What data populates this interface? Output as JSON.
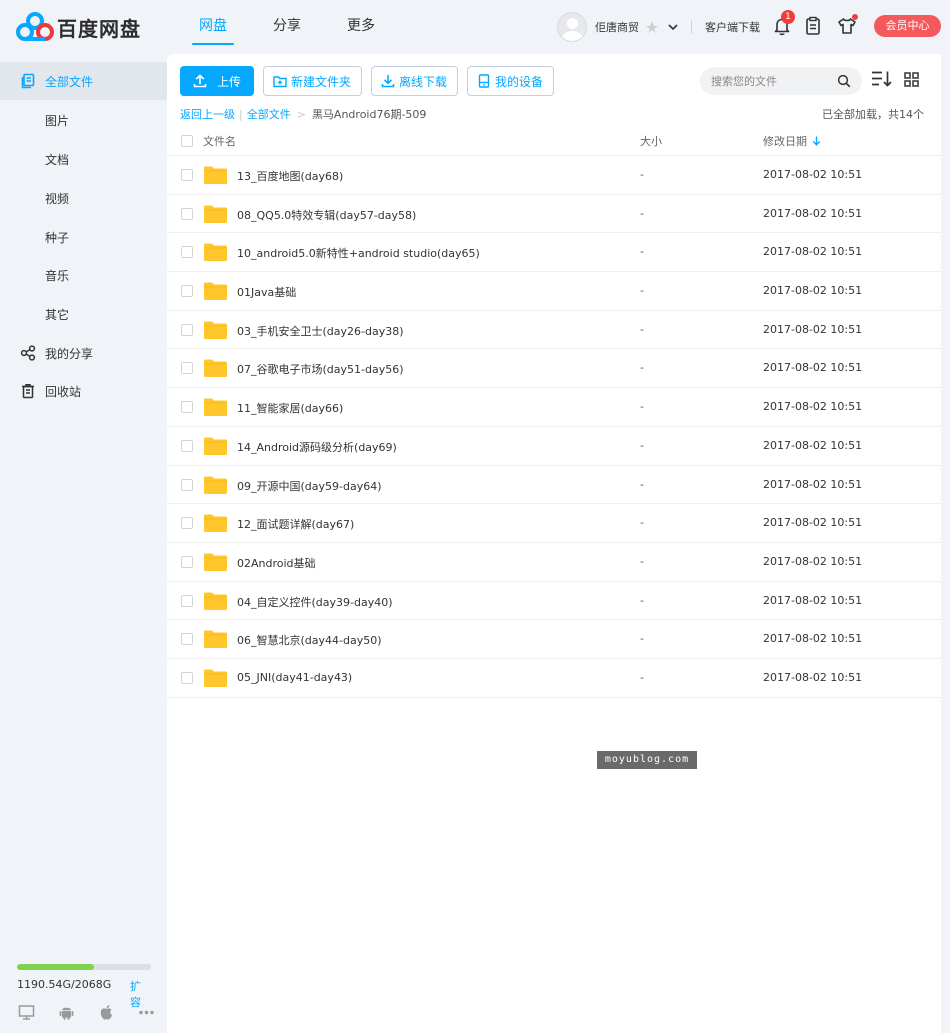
{
  "header": {
    "logo_text": "百度网盘",
    "nav": [
      {
        "label": "网盘",
        "active": true
      },
      {
        "label": "分享",
        "active": false
      },
      {
        "label": "更多",
        "active": false
      }
    ],
    "username": "佢唐商贸",
    "client_download": "客户端下载",
    "notification_count": "1",
    "vip_button": "会员中心"
  },
  "sidebar": {
    "items": [
      {
        "label": "全部文件",
        "icon": "folder-files-icon",
        "active": true
      },
      {
        "label": "图片"
      },
      {
        "label": "文档"
      },
      {
        "label": "视频"
      },
      {
        "label": "种子"
      },
      {
        "label": "音乐"
      },
      {
        "label": "其它"
      },
      {
        "label": "我的分享",
        "icon": "share-icon"
      },
      {
        "label": "回收站",
        "icon": "trash-icon"
      }
    ],
    "quota": {
      "used_text": "1190.54G/2068G",
      "used_fraction": 0.576,
      "expand_label": "扩容"
    },
    "platforms": [
      "desktop-icon",
      "android-icon",
      "apple-icon",
      "more-icon"
    ]
  },
  "toolbar": {
    "upload": "上传",
    "new_folder": "新建文件夹",
    "offline_download": "离线下载",
    "my_devices": "我的设备",
    "search_placeholder": "搜索您的文件"
  },
  "breadcrumb": {
    "back": "返回上一级",
    "root": "全部文件",
    "current": "黑马Android76期-509",
    "loaded_text": "已全部加载，共14个"
  },
  "table": {
    "headers": {
      "name": "文件名",
      "size": "大小",
      "date": "修改日期"
    },
    "rows": [
      {
        "name": "13_百度地图(day68)",
        "size": "-",
        "date": "2017-08-02 10:51"
      },
      {
        "name": "08_QQ5.0特效专辑(day57-day58)",
        "size": "-",
        "date": "2017-08-02 10:51"
      },
      {
        "name": "10_android5.0新特性+android studio(day65)",
        "size": "-",
        "date": "2017-08-02 10:51"
      },
      {
        "name": "01Java基础",
        "size": "-",
        "date": "2017-08-02 10:51"
      },
      {
        "name": "03_手机安全卫士(day26-day38)",
        "size": "-",
        "date": "2017-08-02 10:51"
      },
      {
        "name": "07_谷歌电子市场(day51-day56)",
        "size": "-",
        "date": "2017-08-02 10:51"
      },
      {
        "name": "11_智能家居(day66)",
        "size": "-",
        "date": "2017-08-02 10:51"
      },
      {
        "name": "14_Android源码级分析(day69)",
        "size": "-",
        "date": "2017-08-02 10:51"
      },
      {
        "name": "09_开源中国(day59-day64)",
        "size": "-",
        "date": "2017-08-02 10:51"
      },
      {
        "name": "12_面试题详解(day67)",
        "size": "-",
        "date": "2017-08-02 10:51"
      },
      {
        "name": "02Android基础",
        "size": "-",
        "date": "2017-08-02 10:51"
      },
      {
        "name": "04_自定义控件(day39-day40)",
        "size": "-",
        "date": "2017-08-02 10:51"
      },
      {
        "name": "06_智慧北京(day44-day50)",
        "size": "-",
        "date": "2017-08-02 10:51"
      },
      {
        "name": "05_JNI(day41-day43)",
        "size": "-",
        "date": "2017-08-02 10:51"
      }
    ]
  },
  "watermark": "moyublog.com",
  "colors": {
    "accent": "#06a7ff",
    "vip": "#f4595b",
    "folder": "#ffc72c",
    "quota": "#7fd24d"
  }
}
